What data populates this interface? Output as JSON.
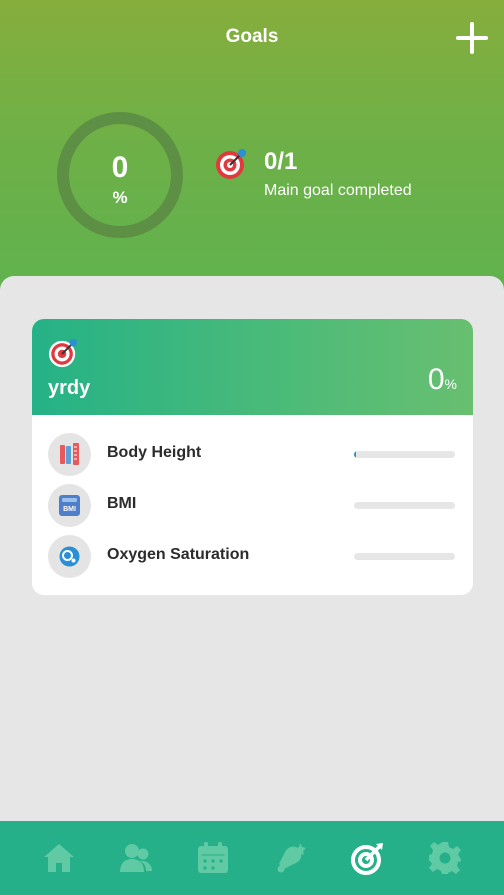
{
  "header": {
    "title": "Goals",
    "add_icon": "plus-icon",
    "progress": {
      "value": "0",
      "unit": "%"
    },
    "goal_count": "0/1",
    "goal_caption": "Main goal completed"
  },
  "goal_card": {
    "name": "yrdy",
    "percent": "0",
    "percent_unit": "%",
    "metrics": [
      {
        "label": "Body Height",
        "icon": "body-height-icon",
        "progress": 0.01
      },
      {
        "label": "BMI",
        "icon": "bmi-scale-icon",
        "icon_text": "BMI",
        "progress": 0
      },
      {
        "label": "Oxygen Saturation",
        "icon": "oxygen-saturation-icon",
        "progress": 0
      }
    ]
  },
  "nav": {
    "items": [
      {
        "icon": "home-icon",
        "active": false
      },
      {
        "icon": "contacts-icon",
        "active": false
      },
      {
        "icon": "calendar-icon",
        "active": false
      },
      {
        "icon": "reminder-bell-icon",
        "active": false
      },
      {
        "icon": "goals-target-icon",
        "active": true
      },
      {
        "icon": "settings-gear-icon",
        "active": false
      }
    ]
  },
  "colors": {
    "header_top": "#86ae3c",
    "header_bottom": "#5fb24f",
    "card_head": "#25b287",
    "nav_bg": "#26b08a",
    "nav_icon_inactive": "#5fcaa3",
    "nav_icon_active": "#ffffff"
  }
}
